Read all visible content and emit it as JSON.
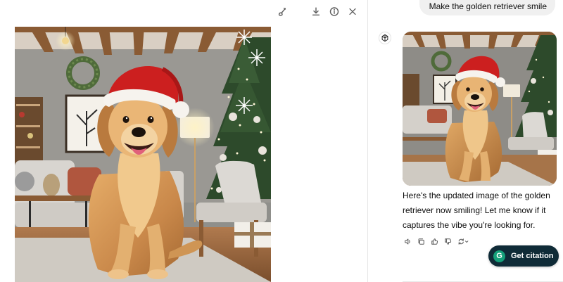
{
  "viewer": {
    "toolbar": [
      {
        "name": "edit-image-button",
        "icon": "brush-icon"
      },
      {
        "name": "download-button",
        "icon": "download-icon"
      },
      {
        "name": "info-button",
        "icon": "info-icon"
      },
      {
        "name": "close-button",
        "icon": "close-icon"
      }
    ],
    "image_alt": "Golden retriever wearing a Santa hat sitting in a Christmas-decorated living room"
  },
  "chat": {
    "user_message": "Make the golden retriever smile",
    "assistant_reply": "Here's the updated image of the golden retriever now smiling! Let me know if it captures the vibe you're looking for.",
    "actions": [
      {
        "name": "read-aloud-button",
        "icon": "speaker-icon"
      },
      {
        "name": "copy-button",
        "icon": "copy-icon"
      },
      {
        "name": "good-response-button",
        "icon": "thumbs-up-icon"
      },
      {
        "name": "bad-response-button",
        "icon": "thumbs-down-icon"
      },
      {
        "name": "regenerate-button",
        "icon": "regenerate-icon"
      }
    ],
    "citation_button": {
      "logo": "G",
      "label": "Get citation"
    }
  },
  "colors": {
    "user_bubble": "#f0f0f0",
    "citation_bg": "#0f2b37",
    "citation_logo": "#14a07a",
    "icon_gray": "#5d5d5d"
  }
}
